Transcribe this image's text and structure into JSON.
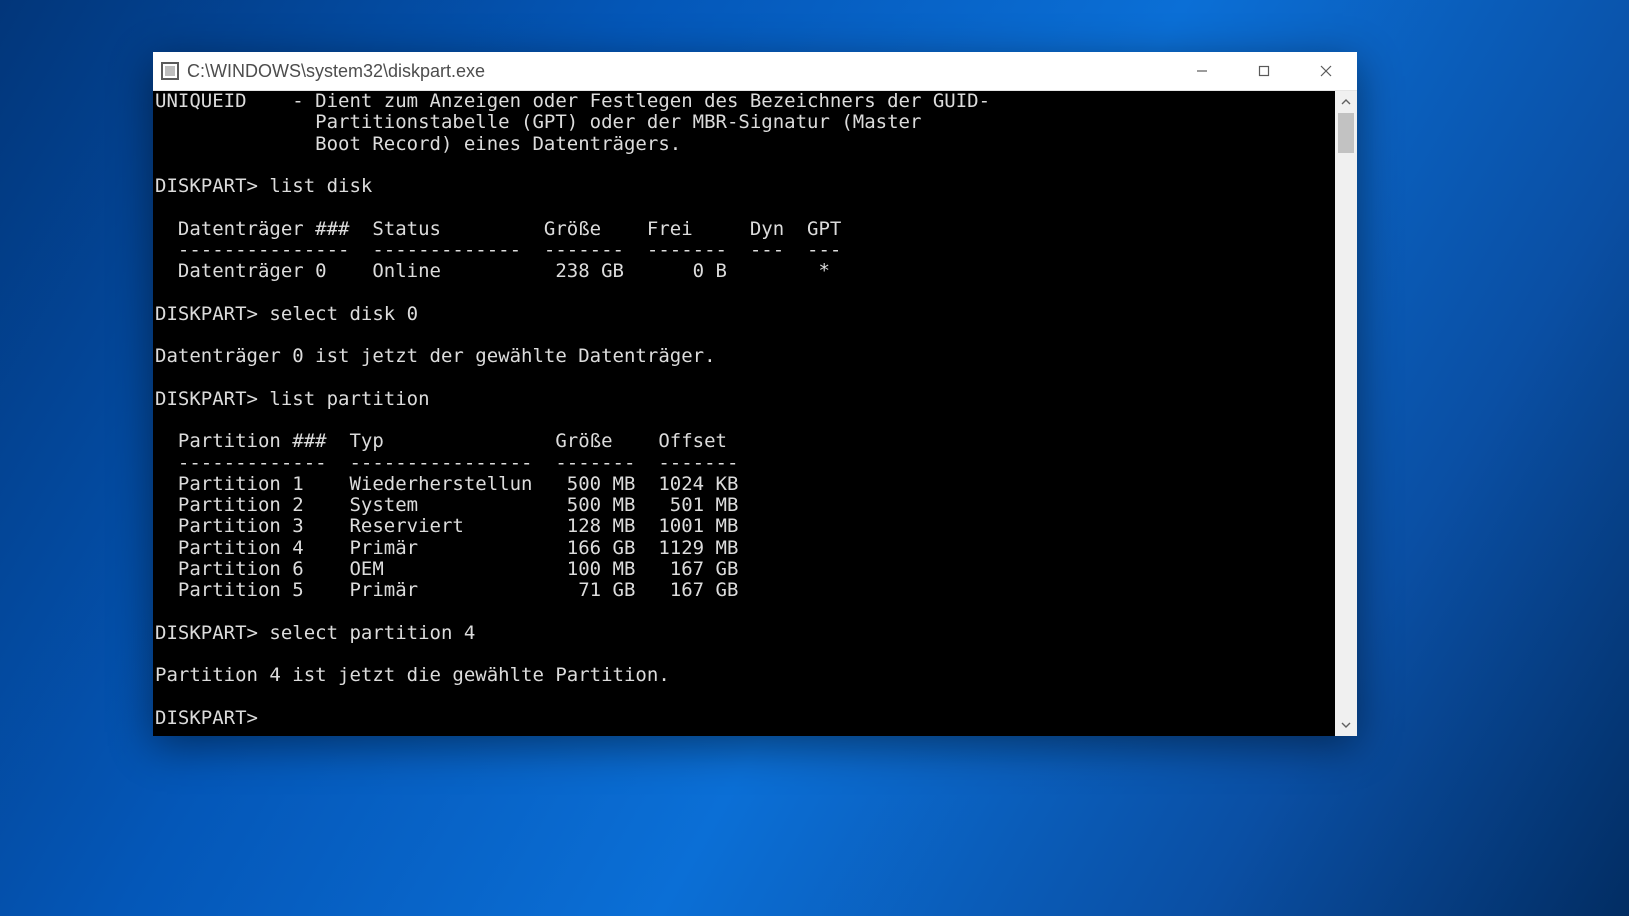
{
  "window": {
    "title": "C:\\WINDOWS\\system32\\diskpart.exe"
  },
  "console": {
    "help_line1": "UNIQUEID    - Dient zum Anzeigen oder Festlegen des Bezeichners der GUID-",
    "help_line2": "              Partitionstabelle (GPT) oder der MBR-Signatur (Master",
    "help_line3": "              Boot Record) eines Datenträgers.",
    "blank": "",
    "prompt1": "DISKPART> list disk",
    "disk_hdr": "  Datenträger ###  Status         Größe    Frei     Dyn  GPT",
    "disk_sep": "  ---------------  -------------  -------  -------  ---  ---",
    "disk_row0": "  Datenträger 0    Online          238 GB      0 B        *",
    "prompt2": "DISKPART> select disk 0",
    "msg_disk": "Datenträger 0 ist jetzt der gewählte Datenträger.",
    "prompt3": "DISKPART> list partition",
    "part_hdr": "  Partition ###  Typ               Größe    Offset",
    "part_sep": "  -------------  ----------------  -------  -------",
    "part_row1": "  Partition 1    Wiederherstellun   500 MB  1024 KB",
    "part_row2": "  Partition 2    System             500 MB   501 MB",
    "part_row3": "  Partition 3    Reserviert         128 MB  1001 MB",
    "part_row4": "  Partition 4    Primär             166 GB  1129 MB",
    "part_row6": "  Partition 6    OEM                100 MB   167 GB",
    "part_row5": "  Partition 5    Primär              71 GB   167 GB",
    "prompt4": "DISKPART> select partition 4",
    "msg_part": "Partition 4 ist jetzt die gewählte Partition.",
    "prompt5": "DISKPART> "
  }
}
